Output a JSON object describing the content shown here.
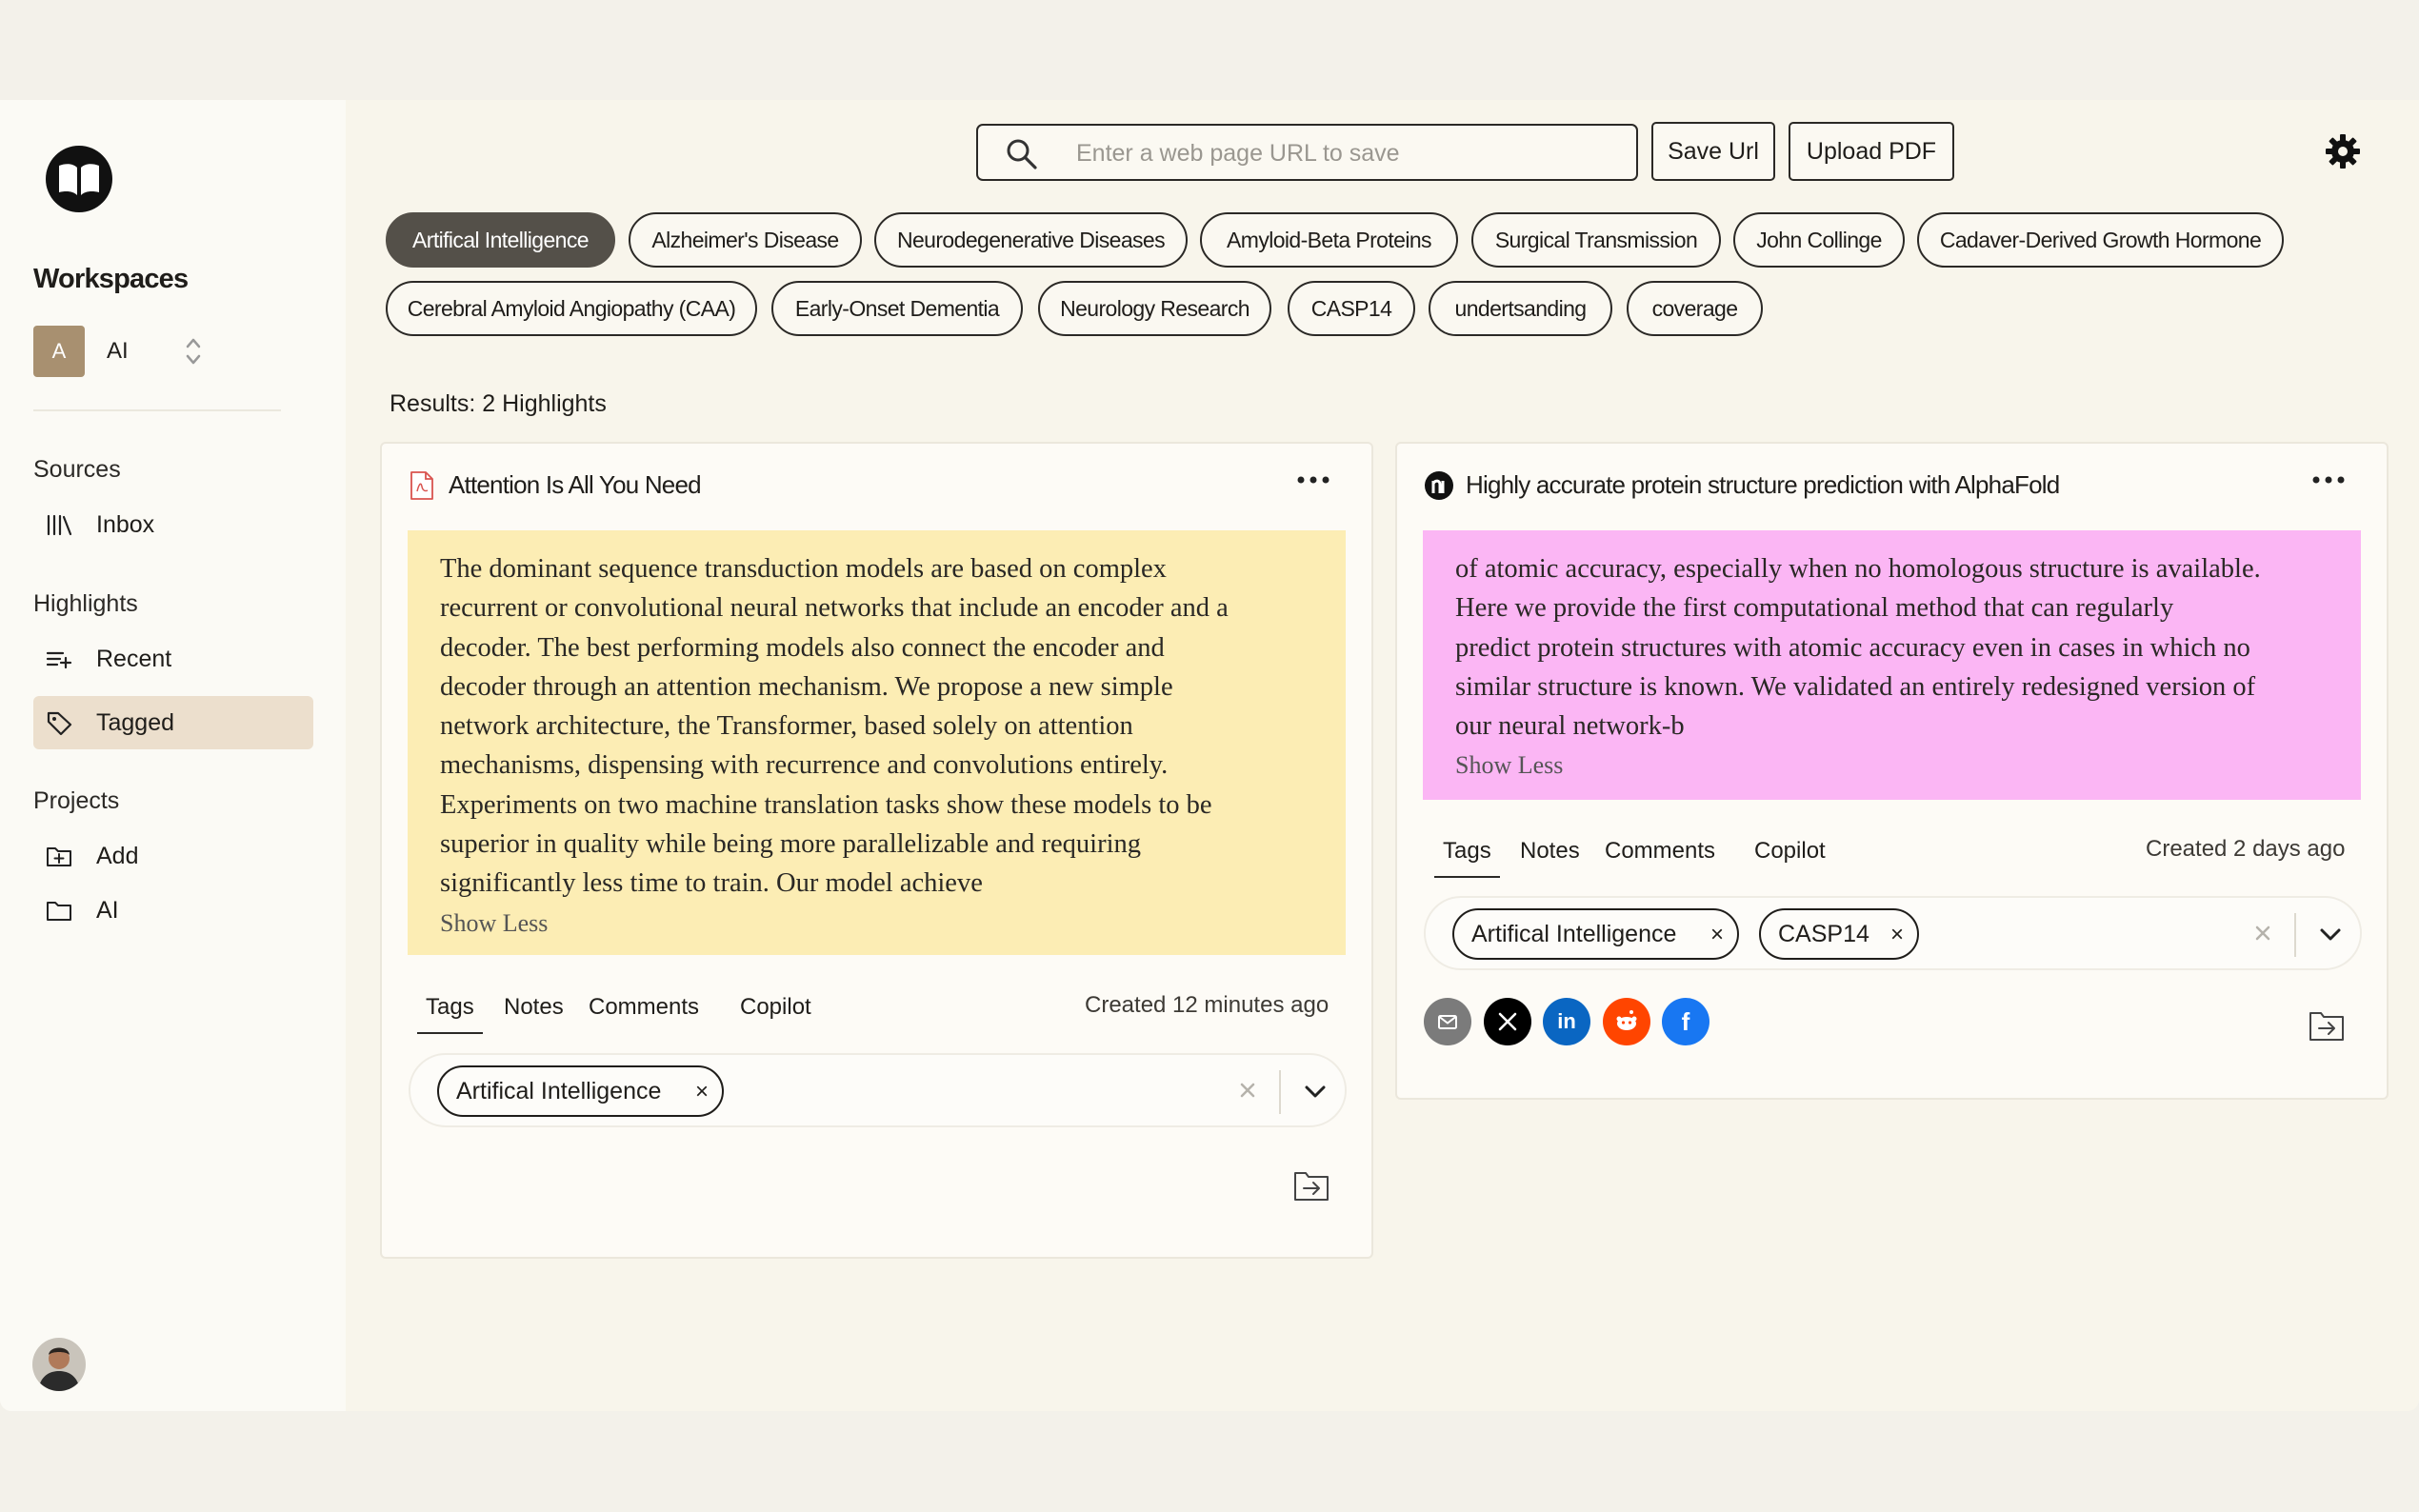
{
  "sidebar": {
    "workspaces_title": "Workspaces",
    "workspace": {
      "avatar_letter": "A",
      "name": "AI"
    },
    "sources_label": "Sources",
    "sources": [
      {
        "label": "Inbox",
        "icon": "library-icon"
      }
    ],
    "highlights_label": "Highlights",
    "highlights": [
      {
        "label": "Recent",
        "icon": "list-add-icon"
      },
      {
        "label": "Tagged",
        "icon": "tag-icon",
        "active": true
      }
    ],
    "projects_label": "Projects",
    "projects": [
      {
        "label": "Add",
        "icon": "folder-add-icon"
      },
      {
        "label": "AI",
        "icon": "folder-icon"
      }
    ]
  },
  "header": {
    "search_placeholder": "Enter a web page URL to save",
    "save_url_label": "Save Url",
    "upload_pdf_label": "Upload PDF"
  },
  "tag_filters": [
    "Artifical Intelligence",
    "Alzheimer's Disease",
    "Neurodegenerative Diseases",
    "Amyloid-Beta Proteins",
    "Surgical Transmission",
    "John Collinge",
    "Cadaver-Derived Growth Hormone",
    "Cerebral Amyloid Angiopathy (CAA)",
    "Early-Onset Dementia",
    "Neurology Research",
    "CASP14",
    "undertsanding",
    "coverage"
  ],
  "active_filter": "Artifical Intelligence",
  "results_label": "Results: 2 Highlights",
  "cards": [
    {
      "title": "Attention Is All You Need",
      "source_icon": "pdf-file-icon",
      "highlight_color": "#fcedb4",
      "quote_lines": [
        "The dominant sequence transduction models are based on complex",
        "recurrent or convolutional neural networks that include an encoder and a",
        "decoder. The best performing models also connect the encoder and",
        "decoder through an attention mechanism. We propose a new simple",
        "network architecture, the Transformer, based solely on attention",
        "mechanisms, dispensing with recurrence and convolutions entirely.",
        "Experiments on two machine translation tasks show these models to be",
        "superior in quality while being more parallelizable and requiring",
        "significantly less time to train. Our model achieve"
      ],
      "show_less": "Show Less",
      "tabs": [
        "Tags",
        "Notes",
        "Comments",
        "Copilot"
      ],
      "active_tab": "Tags",
      "created": "Created 12 minutes ago",
      "tags": [
        "Artifical Intelligence"
      ]
    },
    {
      "title": "Highly accurate protein structure prediction with AlphaFold",
      "source_icon": "nature-logo-icon",
      "highlight_color": "#fbb6f4",
      "quote_lines": [
        "of atomic accuracy, especially when no homologous structure is available.",
        "Here we provide the first computational method that can regularly",
        "predict protein structures with atomic accuracy even in cases in which no",
        "similar structure is known. We validated an entirely redesigned version of",
        "our neural network-b"
      ],
      "show_less": "Show Less",
      "tabs": [
        "Tags",
        "Notes",
        "Comments",
        "Copilot"
      ],
      "active_tab": "Tags",
      "created": "Created 2 days ago",
      "tags": [
        "Artifical Intelligence",
        "CASP14"
      ],
      "share": [
        {
          "name": "email-icon",
          "color": "#7b7b7b"
        },
        {
          "name": "x-icon",
          "color": "#000000"
        },
        {
          "name": "linkedin-icon",
          "color": "#0a66c2"
        },
        {
          "name": "reddit-icon",
          "color": "#ff4500"
        },
        {
          "name": "facebook-icon",
          "color": "#1877f2"
        }
      ]
    }
  ]
}
